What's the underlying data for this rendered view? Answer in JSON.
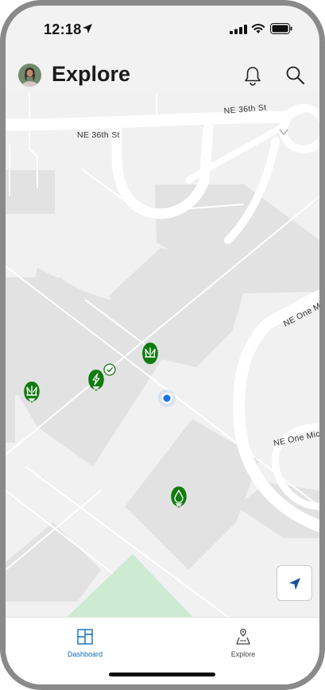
{
  "status_bar": {
    "time": "12:18"
  },
  "header": {
    "title": "Explore"
  },
  "map": {
    "streets": [
      "NE 36th St",
      "NE 36th St",
      "NE One Microsoft Way",
      "NE One Microsoft Way"
    ],
    "markers": [
      {
        "name": "grass",
        "icon": "grass-icon",
        "color": "#107c10"
      },
      {
        "name": "energy",
        "icon": "lightning-icon",
        "color": "#107c10",
        "completed": true
      },
      {
        "name": "grass",
        "icon": "grass-icon",
        "color": "#107c10"
      },
      {
        "name": "water",
        "icon": "water-drop-icon",
        "color": "#107c10"
      }
    ],
    "user_location_color": "#1a73e8",
    "park_color": "#cdebd3"
  },
  "tabs": [
    {
      "label": "Dashboard",
      "icon": "dashboard-icon",
      "active": true,
      "color": "#0f6cbd"
    },
    {
      "label": "Explore",
      "icon": "explore-icon",
      "active": false,
      "color": "#444444"
    }
  ]
}
